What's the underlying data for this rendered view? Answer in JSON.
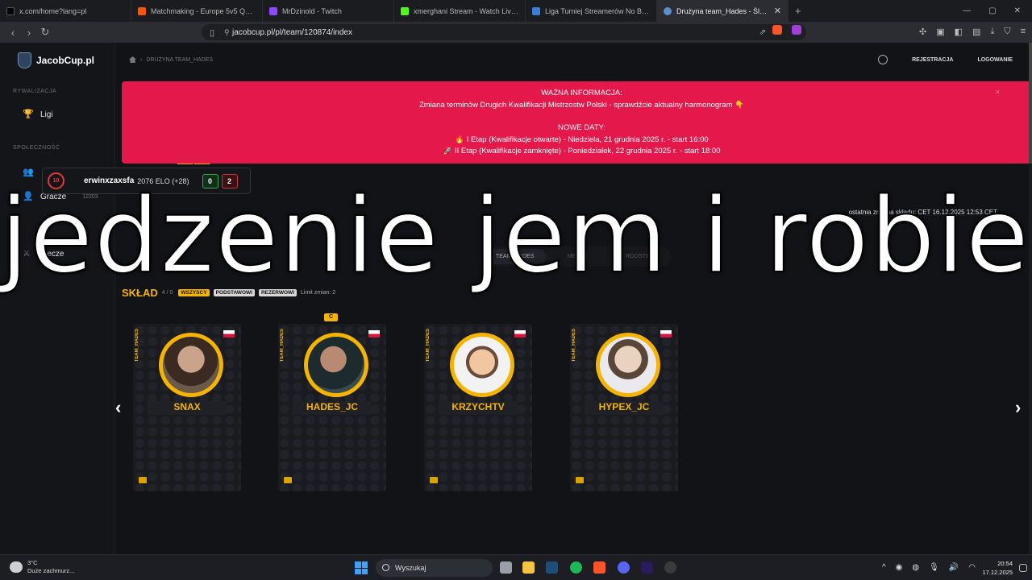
{
  "browser": {
    "tabs": [
      {
        "label": "x.com/home?lang=pl",
        "color": "#000000",
        "active": false
      },
      {
        "label": "Matchmaking - Europe 5v5 Queue -",
        "color": "#ff5500",
        "active": false
      },
      {
        "label": "MrDzinold - Twitch",
        "color": "#9146ff",
        "active": false
      },
      {
        "label": "xmerghani Stream - Watch Live o",
        "color": "#53fc18",
        "active": false
      },
      {
        "label": "Liga Turniej Streamerów No Build D",
        "color": "#3d7dd8",
        "active": false
      },
      {
        "label": "Drużyna team_Hades - Śledź roz",
        "color": "#5a8fd0",
        "active": true
      }
    ],
    "new_tab": "+",
    "url": "jacobcup.pl/pl/team/120874/index"
  },
  "site": {
    "logo_text": "JacobCup.pl",
    "breadcrumb": "DRUŻYNA TEAM_HADES",
    "header": {
      "register": "REJESTRACJA",
      "login": "LOGOWANIE"
    },
    "sidebar": {
      "section_rivalry": "RYWALIZACJA",
      "leagues": "Ligi",
      "section_community": "SPOŁECZNOŚĆ",
      "players": "Gracze",
      "players_count": "12203",
      "matches": "Mecze"
    },
    "alert": {
      "title": "WAŻNA INFORMACJA:",
      "line1": "Zmiana terminów Drugich Kwalifikacji Mistrzostw Polski - sprawdźcie aktualny harmonogram 👇",
      "dates_title": "NOWE DATY:",
      "date1": "🔥 I Etap (Kwalifikacje otwarte) - Niedziela, 21 grudnia 2025 r. - start 16:00",
      "date2": "🚀 II Etap (Kwalifikacje zamknięte) - Poniedziałek, 22 grudnia 2025 r. - start 18:00",
      "close": "×"
    },
    "last_change": "ostatnia zmiana składu: CET 16.12.2025 12:53 CET",
    "toggle": {
      "roster": "TEAM_HADES",
      "matches": "MECZE",
      "rooster": "ROOSTER"
    },
    "roster_section": {
      "title": "SKŁAD",
      "count": "4 / 0",
      "chip_all": "WSZYSCY",
      "chip_main": "PODSTAWOWI",
      "chip_reserve": "REZERWOWI",
      "limit": "Limit zmian: 2",
      "captain_badge": "C"
    },
    "players": [
      {
        "nick": "SNAX",
        "team": "TEAM_HADES"
      },
      {
        "nick": "HADES_JC",
        "team": "TEAM_HADES"
      },
      {
        "nick": "KRZYCHTV",
        "team": "TEAM_HADES"
      },
      {
        "nick": "HYPEX_JC",
        "team": "TEAM_HADES"
      }
    ]
  },
  "overlay": {
    "faceit_level": "10",
    "player": "erwinxzaxsfa",
    "elo": "2076 ELO (+28)",
    "wins": "0",
    "losses": "2",
    "caption": "jedzenie jem i robie"
  },
  "taskbar": {
    "temp": "3°C",
    "weather": "Duże zachmurz...",
    "search": "Wyszukaj",
    "time": "20:54",
    "date": "17.12.2025"
  },
  "colors": {
    "accent": "#f5b400",
    "alert": "#e4184a",
    "bg": "#121317"
  }
}
